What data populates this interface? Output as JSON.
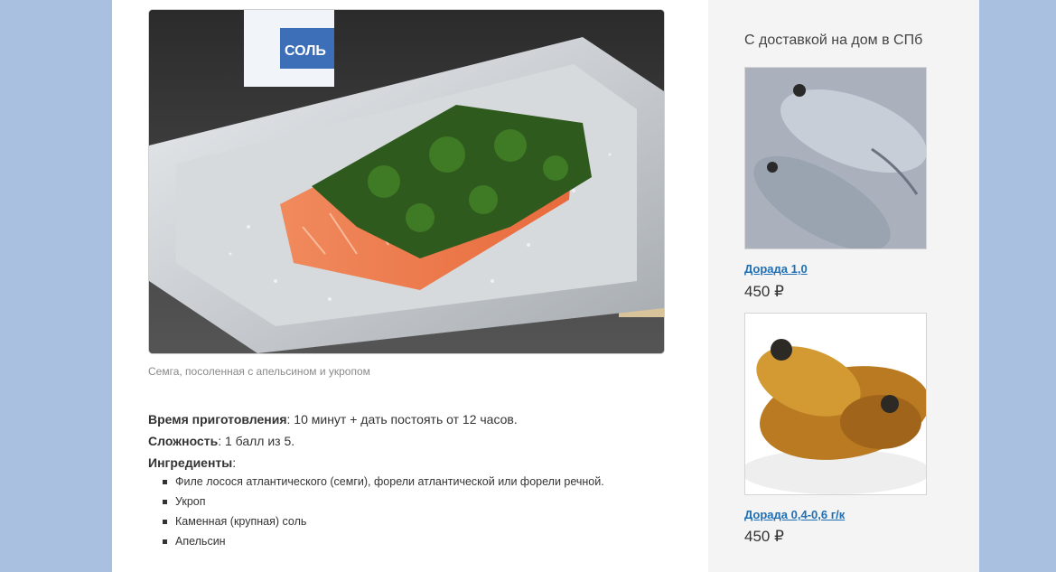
{
  "article": {
    "image_alt": "Семга, посоленная с апельсином и укропом",
    "caption": "Семга, посоленная с апельсином и укропом",
    "prep_time_label": "Время приготовления",
    "prep_time_value": ": 10 минут + дать постоять от 12 часов.",
    "difficulty_label": "Сложность",
    "difficulty_value": ": 1 балл из 5.",
    "ingredients_label": "Ингредиенты",
    "ingredients_colon": ":",
    "ingredients": [
      "Филе лосося атлантического (семги), форели атлантической или форели речной.",
      "Укроп",
      "Каменная (крупная) соль",
      "Апельсин"
    ],
    "salt_box_text": "СОЛЬ"
  },
  "sidebar": {
    "title": "С доставкой на дом в СПб",
    "products": [
      {
        "name": "Дорада 1,0",
        "price": "450 ₽"
      },
      {
        "name": "Дорада 0,4-0,6 г/к",
        "price": "450 ₽"
      }
    ]
  },
  "colors": {
    "background": "#a9c0e0",
    "link": "#1f6fb5",
    "sidebar_bg": "#f4f4f4"
  }
}
